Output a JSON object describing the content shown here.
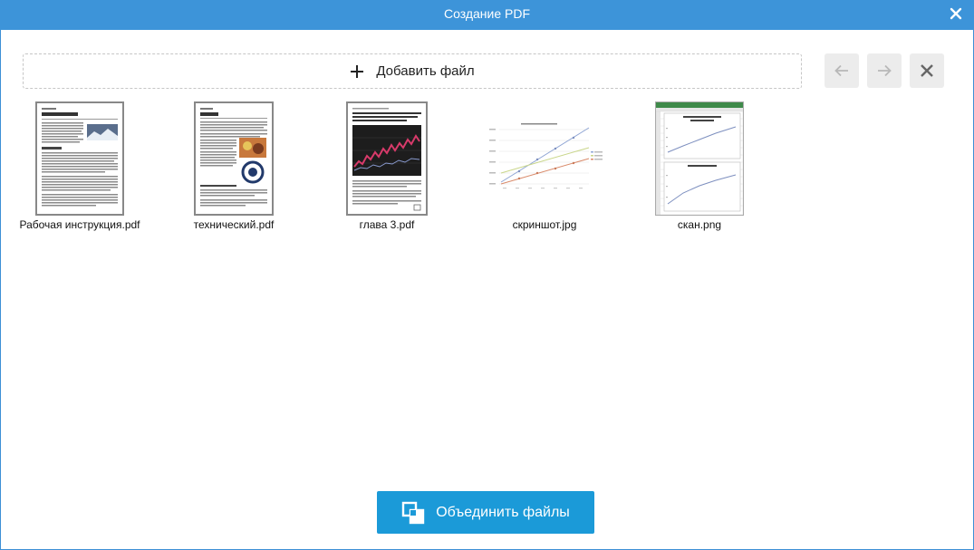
{
  "window": {
    "title": "Создание PDF",
    "close_icon": "close-icon"
  },
  "toolbar": {
    "add_label": "Добавить файл",
    "add_icon": "plus-icon",
    "prev_icon": "arrow-left-icon",
    "next_icon": "arrow-right-icon",
    "delete_icon": "close-icon"
  },
  "files": [
    {
      "name": "Рабочая инструкция.pdf",
      "kind": "pdf-document"
    },
    {
      "name": "технический.pdf",
      "kind": "pdf-document"
    },
    {
      "name": "глава 3.pdf",
      "kind": "pdf-document"
    },
    {
      "name": "скриншот.jpg",
      "kind": "image-chart"
    },
    {
      "name": "скан.png",
      "kind": "image-spreadsheet"
    }
  ],
  "footer": {
    "merge_label": "Объединить файлы",
    "merge_icon": "merge-icon"
  },
  "colors": {
    "titlebar": "#3d94d9",
    "merge_button": "#1b9ad8",
    "toolbar_button": "#ececec"
  }
}
